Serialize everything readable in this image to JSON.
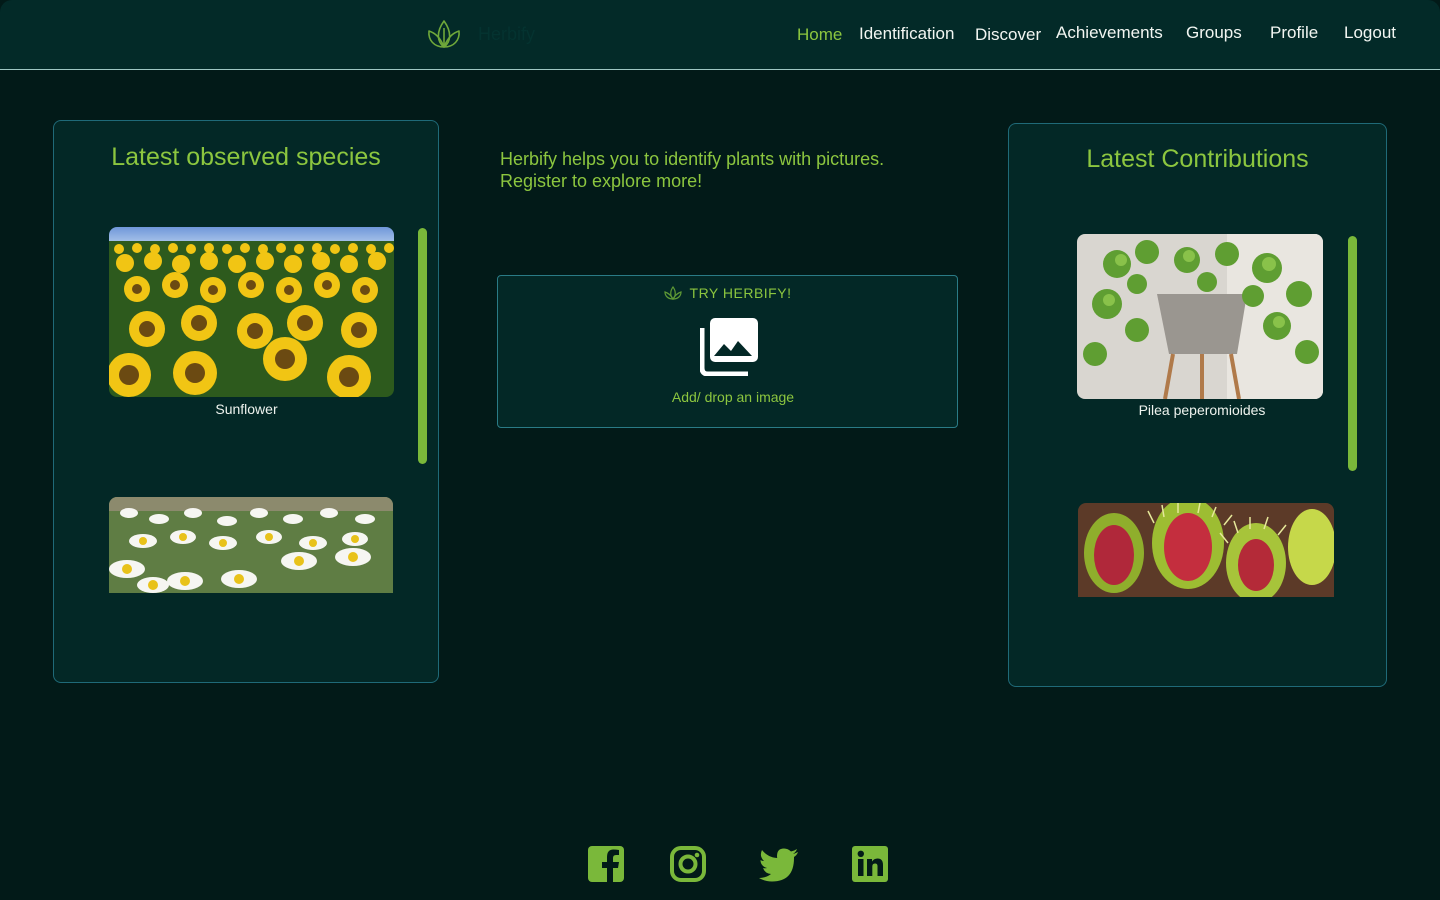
{
  "header": {
    "brand": "Herbify",
    "nav": [
      {
        "label": "Home",
        "active": true
      },
      {
        "label": "Identification",
        "active": false
      },
      {
        "label": "Discover",
        "active": false
      },
      {
        "label": "Achievements",
        "active": false
      },
      {
        "label": "Groups",
        "active": false
      },
      {
        "label": "Profile",
        "active": false
      },
      {
        "label": "Logout",
        "active": false
      }
    ]
  },
  "left_panel": {
    "title": "Latest observed species",
    "items": [
      {
        "name": "Sunflower",
        "image": "sunflower-field"
      },
      {
        "name": "",
        "image": "daisy-field"
      }
    ]
  },
  "center": {
    "intro_line1": "Herbify helps you to identify plants with pictures.",
    "intro_line2": "Register to explore more!",
    "try_label": "TRY HERBIFY!",
    "drop_label": "Add/ drop an image"
  },
  "right_panel": {
    "title": "Latest Contributions",
    "items": [
      {
        "name": "Pilea peperomioides",
        "image": "pilea-plant"
      },
      {
        "name": "",
        "image": "venus-flytrap"
      }
    ]
  },
  "footer": {
    "social": [
      "facebook-icon",
      "instagram-icon",
      "twitter-icon",
      "linkedin-icon"
    ]
  },
  "colors": {
    "background": "#021a18",
    "header": "#032a28",
    "panel": "#032826",
    "accent": "#8cc63f",
    "border": "#1f6a78"
  }
}
